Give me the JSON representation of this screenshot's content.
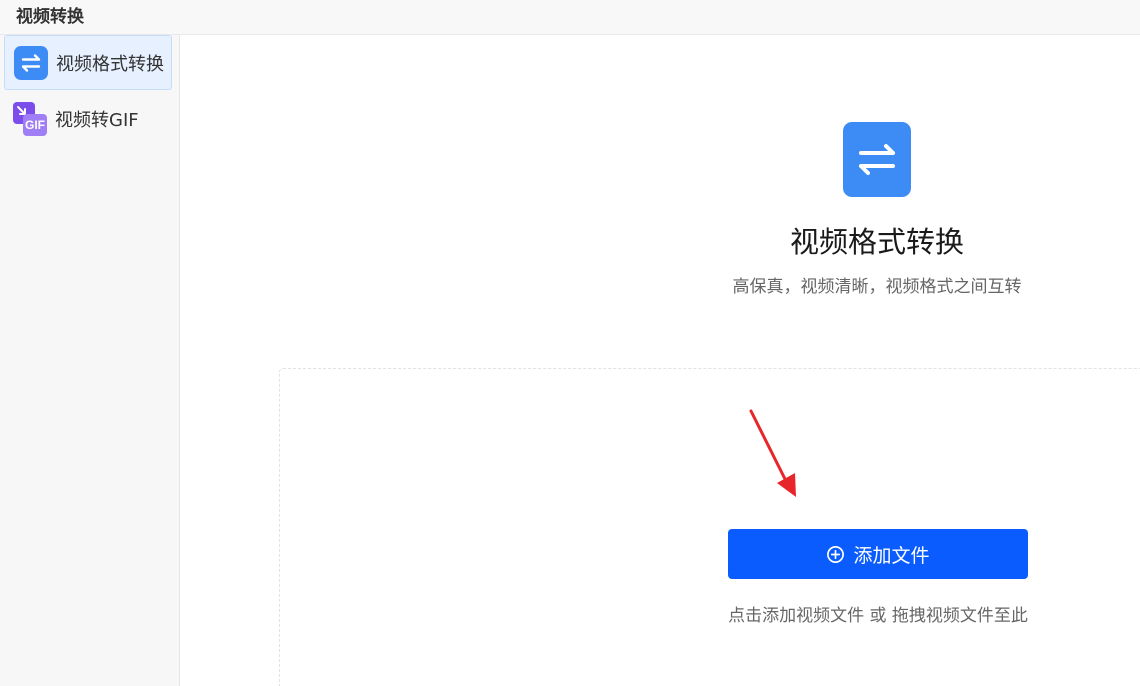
{
  "window": {
    "title": "视频转换"
  },
  "sidebar": {
    "items": [
      {
        "label": "视频格式转换",
        "icon": "swap-arrows-icon",
        "active": true
      },
      {
        "label": "视频转GIF",
        "icon": "gif-icon",
        "icon_text": "GIF",
        "active": false
      }
    ]
  },
  "main": {
    "icon": "swap-arrows-icon",
    "title": "视频格式转换",
    "subtitle": "高保真，视频清晰，视频格式之间互转",
    "add_button_label": "添加文件",
    "add_button_icon": "plus-circle-icon",
    "hint": "点击添加视频文件 或 拖拽视频文件至此"
  },
  "colors": {
    "accent": "#3d8bf5",
    "button": "#0a5cff",
    "annotation_arrow": "#e8262a",
    "gif_icon_back": "#7b4dea",
    "gif_icon_front": "#a07ef5"
  }
}
